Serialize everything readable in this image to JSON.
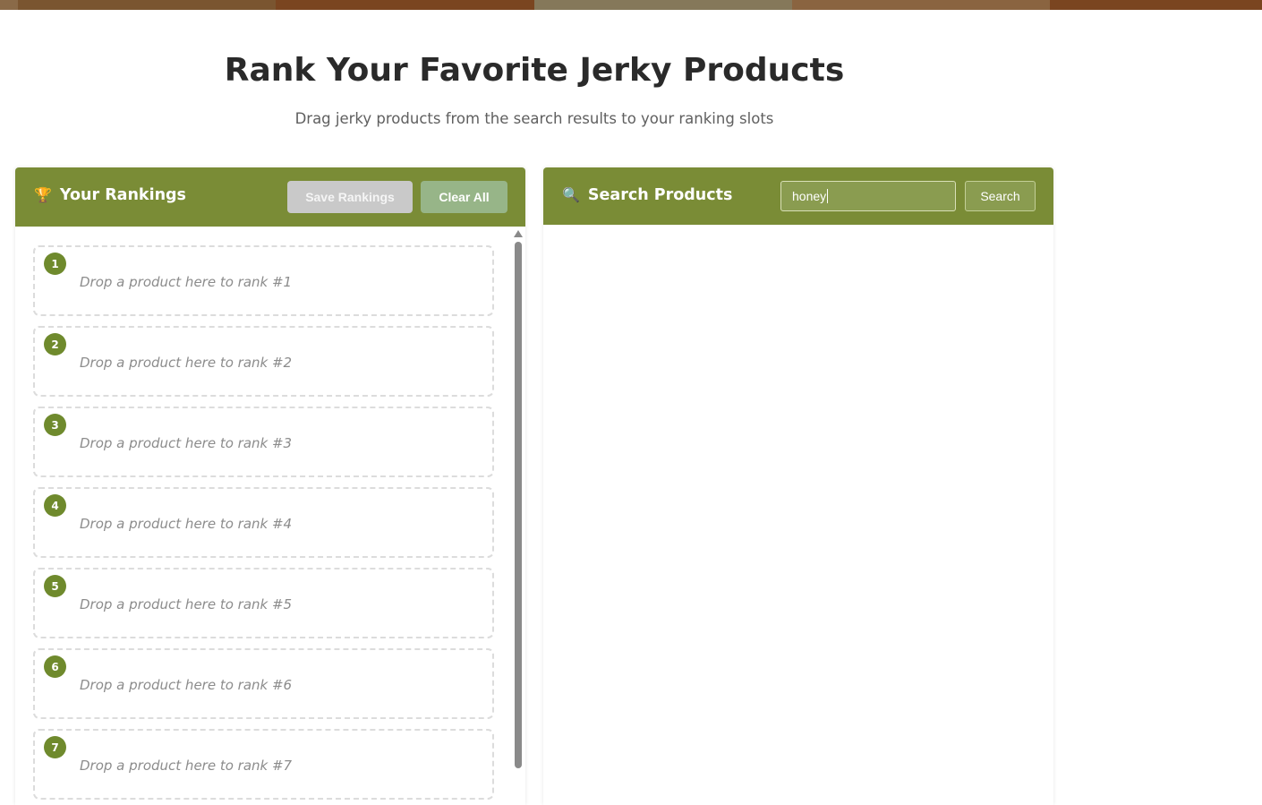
{
  "page": {
    "title": "Rank Your Favorite Jerky Products",
    "subtitle": "Drag jerky products from the search results to your ranking slots"
  },
  "top_bar": {
    "colors": [
      "#7a5530",
      "#7a4520",
      "#85785a",
      "#8a6440",
      "#7a4520"
    ]
  },
  "rankings": {
    "icon": "trophy-icon",
    "title": "Your Rankings",
    "save_label": "Save Rankings",
    "clear_label": "Clear All",
    "slots": [
      {
        "rank": "1",
        "placeholder": "Drop a product here to rank #1"
      },
      {
        "rank": "2",
        "placeholder": "Drop a product here to rank #2"
      },
      {
        "rank": "3",
        "placeholder": "Drop a product here to rank #3"
      },
      {
        "rank": "4",
        "placeholder": "Drop a product here to rank #4"
      },
      {
        "rank": "5",
        "placeholder": "Drop a product here to rank #5"
      },
      {
        "rank": "6",
        "placeholder": "Drop a product here to rank #6"
      },
      {
        "rank": "7",
        "placeholder": "Drop a product here to rank #7"
      }
    ]
  },
  "search": {
    "icon": "magnifier-icon",
    "title": "Search Products",
    "query": "honey",
    "button_label": "Search"
  },
  "colors": {
    "header_green": "#7a8c36",
    "badge_green": "#6f8a2d",
    "clear_button": "#97b588",
    "save_button_disabled": "#c9c9c9"
  }
}
